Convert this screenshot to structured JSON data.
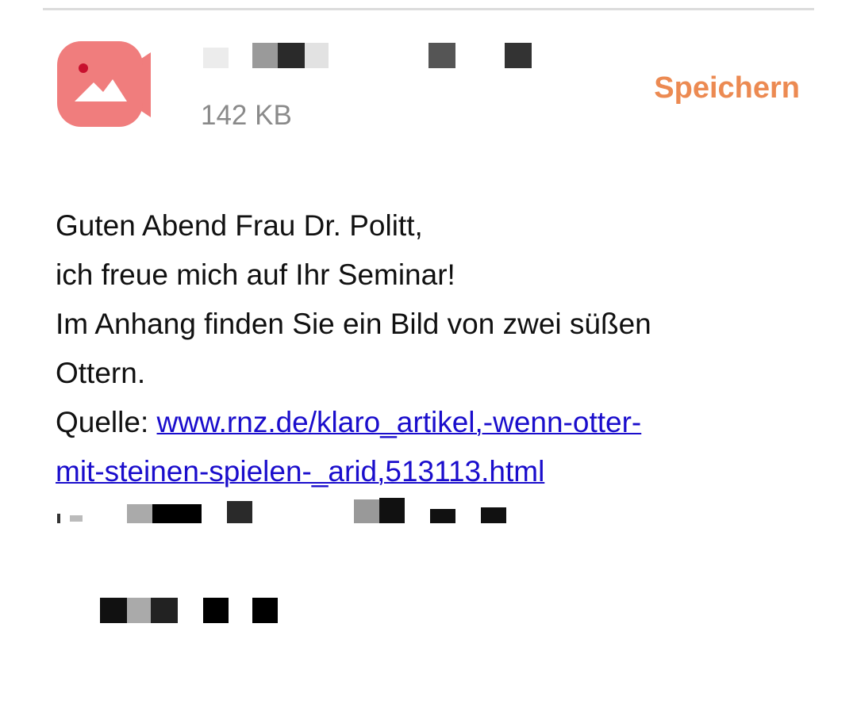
{
  "attachment": {
    "icon": "image-attachment-icon",
    "icon_color": "#f07d7d",
    "file_size": "142 KB",
    "save_label": "Speichern",
    "save_color": "#ec8a52"
  },
  "message": {
    "greeting": "Guten Abend Frau Dr. Politt,",
    "line2": "ich freue mich auf Ihr Seminar!",
    "line3": "Im Anhang finden Sie ein Bild von zwei süßen",
    "line4": "Ottern.",
    "source_label": "Quelle: ",
    "source_link_part1": "www.rnz.de/klaro_artikel,-wenn-otter-",
    "source_link_part2": "mit-steinen-spielen-_arid,513113.html",
    "link_color": "#1a0dcc"
  }
}
